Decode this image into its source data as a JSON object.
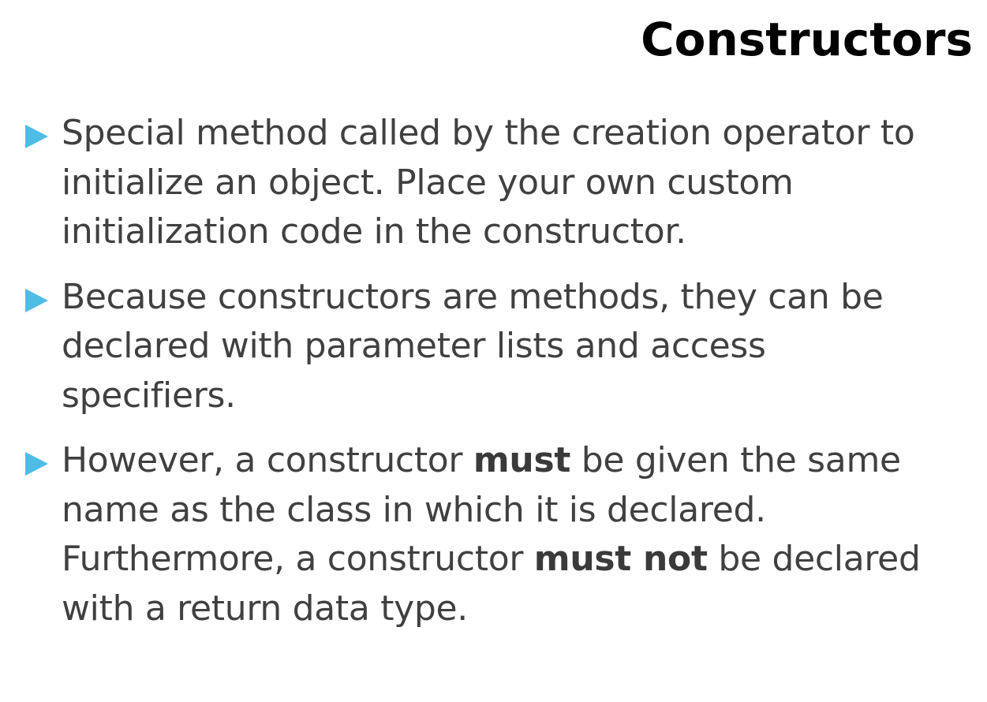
{
  "slide": {
    "title": "Constructors",
    "bullet_icon": "triangle-right-icon",
    "bullet_color": "#4dbde6",
    "bullets": [
      {
        "lines": [
          "Special method called by the creation operator to",
          "initialize an object. Place your own custom",
          "initialization code in the constructor."
        ]
      },
      {
        "lines": [
          "Because constructors are methods, they can be",
          "declared with parameter lists and access",
          "specifiers."
        ]
      },
      {
        "line1_before": "However, a constructor ",
        "line1_bold": "must",
        "line1_after": " be given the same",
        "line2": "name as the class in which it is declared.",
        "line3_before": "Furthermore, a constructor ",
        "line3_bold": "must not",
        "line3_after": " be declared",
        "line4": "with a return data type."
      }
    ]
  }
}
